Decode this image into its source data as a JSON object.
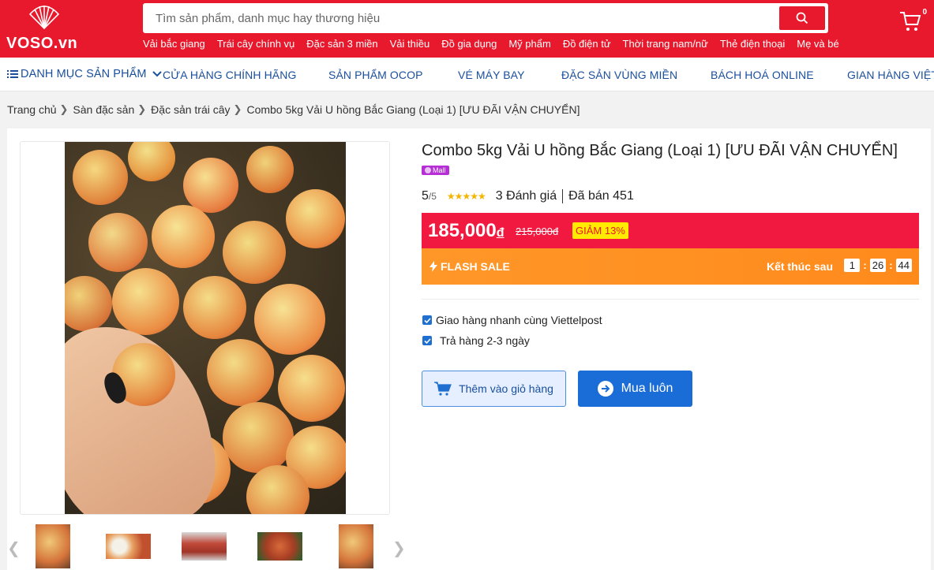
{
  "header": {
    "brand": "VOSO.vn",
    "search_placeholder": "Tìm sản phẩm, danh mục hay thương hiệu",
    "cart_count": "0",
    "quick_links": [
      "Vải bắc giang",
      "Trái cây chính vụ",
      "Đặc sản 3 miền",
      "Vải thiều",
      "Đồ gia dụng",
      "Mỹ phẩm",
      "Đồ điện tử",
      "Thời trang nam/nữ",
      "Thẻ điện thoại",
      "Mẹ và bé"
    ],
    "color": "#e8192c"
  },
  "nav": {
    "categories": "DANH MỤC SẢN PHẨM",
    "items": [
      "CỬA HÀNG CHÍNH HÃNG",
      "SẢN PHẨM OCOP",
      "VÉ MÁY BAY",
      "ĐẶC SẢN VÙNG MIỀN",
      "BÁCH HOÁ ONLINE",
      "GIAN HÀNG VIỆT"
    ]
  },
  "breadcrumb": [
    "Trang chủ",
    "Sàn đặc sản",
    "Đặc sản trái cây",
    "Combo 5kg Vải U hồng Bắc Giang (Loại 1) [ƯU ĐÃI VẬN CHUYỂN]"
  ],
  "product": {
    "title": "Combo 5kg Vải U hồng Bắc Giang (Loại 1) [ƯU ĐÃI VẬN CHUYỂN]",
    "mall_badge": "Mall",
    "rating": "5",
    "rating_max": "/5",
    "reviews": "3 Đánh giá",
    "sold": "Đã bán 451",
    "price": "185,000",
    "currency": "đ",
    "old_price": "215,000đ",
    "discount": "GIẢM 13%",
    "flash_sale": "FLASH SALE",
    "ends_label": "Kết thúc sau",
    "timer": [
      "1",
      "26",
      "44"
    ],
    "features": [
      "Giao hàng nhanh cùng Viettelpost",
      "Trả hàng 2-3 ngày"
    ],
    "add_to_cart": "Thêm vào giỏ hàng",
    "buy_now": "Mua luôn"
  }
}
